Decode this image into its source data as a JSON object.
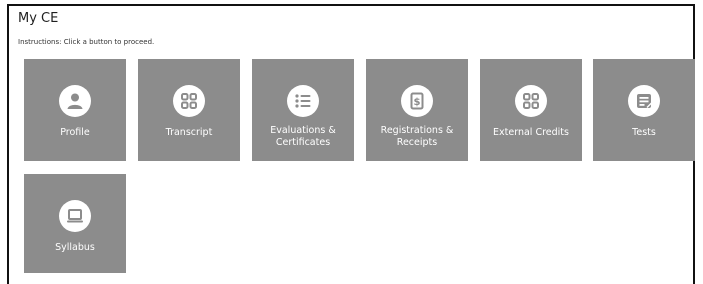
{
  "header": {
    "title": "My CE",
    "instructions": "Instructions: Click a button to proceed."
  },
  "tiles": [
    {
      "label": "Profile",
      "icon": "person-icon"
    },
    {
      "label": "Transcript",
      "icon": "grid-icon"
    },
    {
      "label": "Evaluations & Certificates",
      "icon": "list-icon"
    },
    {
      "label": "Registrations & Receipts",
      "icon": "dollar-receipt-icon"
    },
    {
      "label": "External Credits",
      "icon": "grid-icon"
    },
    {
      "label": "Tests",
      "icon": "test-form-icon"
    },
    {
      "label": "Syllabus",
      "icon": "laptop-icon"
    }
  ],
  "colors": {
    "tile": "#8c8c8c",
    "icon_bg": "#ffffff",
    "icon_fg": "#8c8c8c"
  }
}
